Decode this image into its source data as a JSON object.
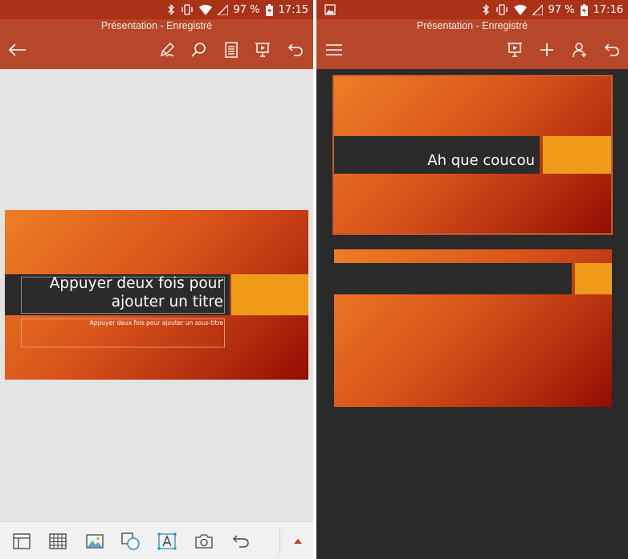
{
  "left": {
    "status": {
      "battery": "97 %",
      "time": "17:15"
    },
    "app_title": "Présentation - Enregistré",
    "slide": {
      "title_placeholder": "Appuyer deux fois pour ajouter un titre",
      "subtitle_placeholder": "Appuyer deux fois pour ajouter un sous-titre"
    }
  },
  "right": {
    "status": {
      "battery": "97 %",
      "time": "17:16"
    },
    "app_title": "Présentation - Enregistré",
    "slides": [
      {
        "title": "Ah que coucou"
      },
      {
        "title": ""
      }
    ]
  },
  "icons": {
    "back": "arrow-left-icon",
    "draw": "pen-icon",
    "search": "search-icon",
    "notes": "notes-icon",
    "present": "present-icon",
    "undo": "undo-icon",
    "menu": "hamburger-icon",
    "add": "plus-icon",
    "share": "share-person-icon"
  },
  "colors": {
    "status_bar": "#a93219",
    "app_bar": "#b7472a",
    "slide_accent": "#f19a1a",
    "title_band": "#2b2b2b",
    "thumbnail_pane": "#2a2a2a"
  }
}
